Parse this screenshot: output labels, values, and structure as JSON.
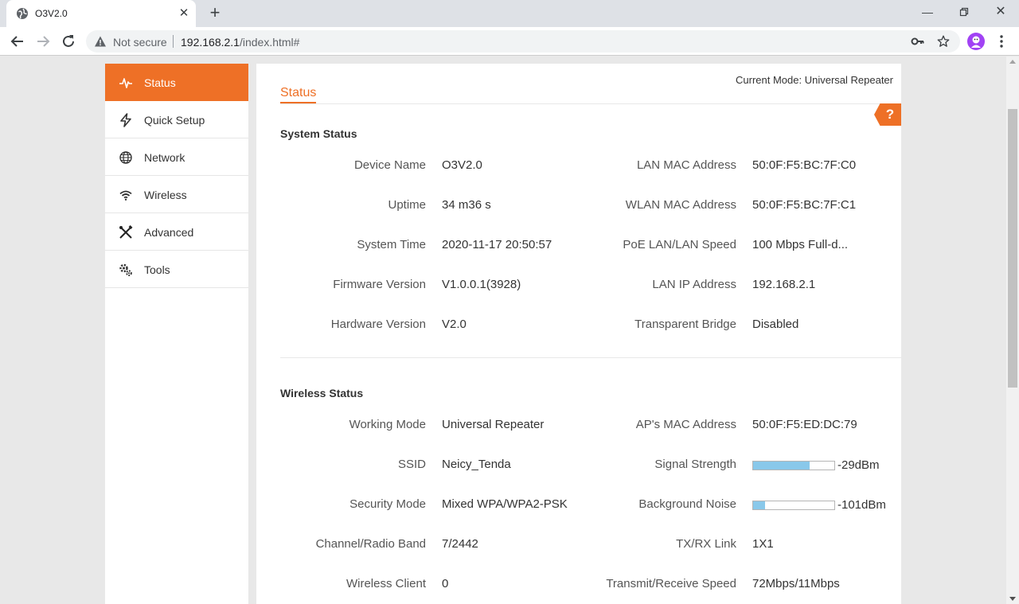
{
  "browser": {
    "tab_title": "O3V2.0",
    "new_tab_label": "+",
    "security_label": "Not secure",
    "url_host": "192.168.2.1",
    "url_path": "/index.html#"
  },
  "sidebar": {
    "items": [
      {
        "label": "Status",
        "icon": "pulse-icon",
        "active": true
      },
      {
        "label": "Quick Setup",
        "icon": "lightning-icon",
        "active": false
      },
      {
        "label": "Network",
        "icon": "globe-icon",
        "active": false
      },
      {
        "label": "Wireless",
        "icon": "wifi-icon",
        "active": false
      },
      {
        "label": "Advanced",
        "icon": "tools-cross-icon",
        "active": false
      },
      {
        "label": "Tools",
        "icon": "gears-icon",
        "active": false
      }
    ]
  },
  "header": {
    "current_mode": "Current Mode: Universal Repeater",
    "page_tab": "Status",
    "help": "?"
  },
  "system_status": {
    "title": "System Status",
    "rows": [
      {
        "label_l": "Device Name",
        "value_l": "O3V2.0",
        "label_r": "LAN MAC Address",
        "value_r": "50:0F:F5:BC:7F:C0"
      },
      {
        "label_l": "Uptime",
        "value_l": "34 m36 s",
        "label_r": "WLAN MAC Address",
        "value_r": "50:0F:F5:BC:7F:C1"
      },
      {
        "label_l": "System Time",
        "value_l": "2020-11-17 20:50:57",
        "label_r": "PoE LAN/LAN Speed",
        "value_r": "100 Mbps Full-d..."
      },
      {
        "label_l": "Firmware Version",
        "value_l": "V1.0.0.1(3928)",
        "label_r": "LAN IP Address",
        "value_r": "192.168.2.1"
      },
      {
        "label_l": "Hardware Version",
        "value_l": "V2.0",
        "label_r": "Transparent Bridge",
        "value_r": "Disabled"
      }
    ]
  },
  "wireless_status": {
    "title": "Wireless Status",
    "rows": [
      {
        "label_l": "Working Mode",
        "value_l": "Universal Repeater",
        "label_r": "AP's MAC Address",
        "value_r": "50:0F:F5:ED:DC:79"
      },
      {
        "label_l": "SSID",
        "value_l": "Neicy_Tenda",
        "label_r": "Signal Strength",
        "value_r": "-29dBm"
      },
      {
        "label_l": "Security Mode",
        "value_l": "Mixed WPA/WPA2-PSK",
        "label_r": "Background Noise",
        "value_r": "-101dBm"
      },
      {
        "label_l": "Channel/Radio Band",
        "value_l": "7/2442",
        "label_r": "TX/RX Link",
        "value_r": "1X1"
      },
      {
        "label_l": "Wireless Client",
        "value_l": "0",
        "label_r": "Transmit/Receive Speed",
        "value_r": "72Mbps/11Mbps"
      }
    ],
    "signal_strength_level": 0.7,
    "background_noise_level": 0.15
  },
  "colors": {
    "accent": "#ee7026",
    "meter_fill": "#89c8ea"
  }
}
